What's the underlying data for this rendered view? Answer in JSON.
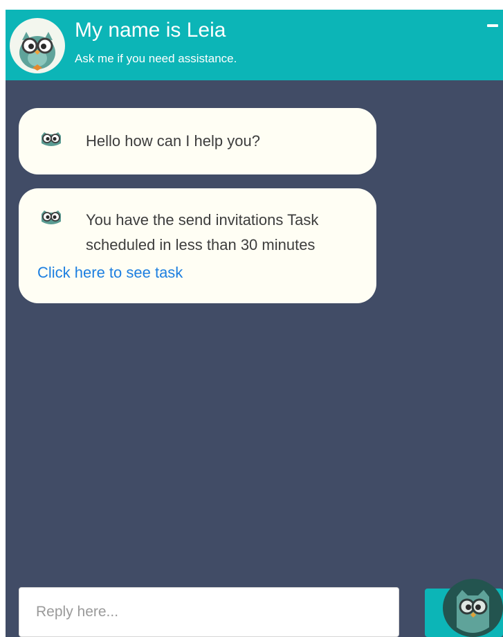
{
  "header": {
    "title": "My name is Leia",
    "subtitle": "Ask me if you need assistance.",
    "avatar_icon": "owl-icon",
    "minimize_icon": "minimize-icon"
  },
  "messages": [
    {
      "icon": "owl-icon",
      "text": "Hello how can I help you?"
    },
    {
      "icon": "owl-icon",
      "text": "You have the send invitations Task scheduled in less than 30 minutes",
      "link": "Click here to see task"
    }
  ],
  "composer": {
    "placeholder": "Reply here...",
    "value": ""
  },
  "colors": {
    "header_background": "#0cb5b7",
    "chat_background": "#414c66",
    "bubble_background": "#fffef4",
    "link": "#1d7fe0",
    "send_button": "#0cb5b7"
  }
}
